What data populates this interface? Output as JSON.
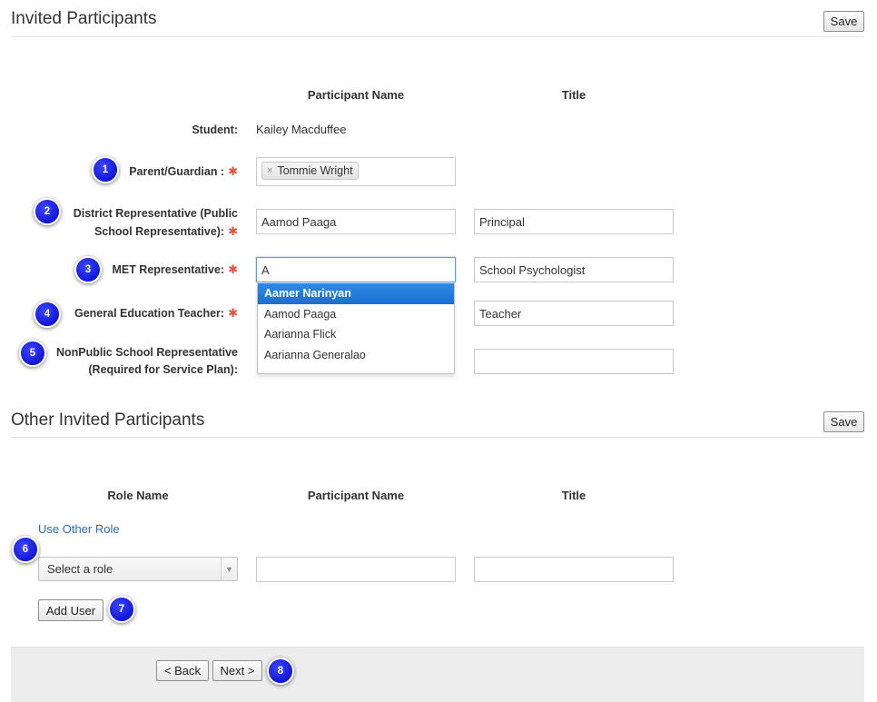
{
  "invited": {
    "title": "Invited Participants",
    "save_label": "Save",
    "col_participant": "Participant Name",
    "col_title": "Title",
    "student": {
      "label": "Student:",
      "value": "Kailey Macduffee"
    },
    "parent": {
      "label": "Parent/Guardian :",
      "required": "✱",
      "tag": "Tommie Wright",
      "tag_remove": "×"
    },
    "district": {
      "label_line1": "District Representative (Public",
      "label_line2": "School Representative):",
      "required": "✱",
      "name": "Aamod Paaga",
      "title": "Principal"
    },
    "met": {
      "label": "MET Representative:",
      "required": "✱",
      "name": "A",
      "title": "School Psychologist"
    },
    "gen_ed": {
      "label": "General Education Teacher:",
      "required": "✱",
      "title": "Teacher"
    },
    "nonpublic": {
      "label_line1": "NonPublic School Representative",
      "label_line2": "(Required for Service Plan):",
      "title": ""
    },
    "autocomplete": [
      "Aamer Narinyan",
      "Aamod Paaga",
      "Aarianna Flick",
      "Aarianna Generalao"
    ]
  },
  "other": {
    "title": "Other Invited Participants",
    "save_label": "Save",
    "col_role": "Role Name",
    "col_participant": "Participant Name",
    "col_title": "Title",
    "use_other_role": "Use Other Role",
    "role_select": "Select a role",
    "role_arrow": "▼",
    "participant": "",
    "title_value": "",
    "add_user_label": "Add User"
  },
  "footer": {
    "back_label": "< Back",
    "next_label": "Next >"
  },
  "callouts": [
    "1",
    "2",
    "3",
    "4",
    "5",
    "6",
    "7",
    "8"
  ],
  "colors": {
    "accent": "#1a6fd0",
    "required": "#e8503a",
    "badge": "#1116d6",
    "link": "#2a6eb5"
  }
}
